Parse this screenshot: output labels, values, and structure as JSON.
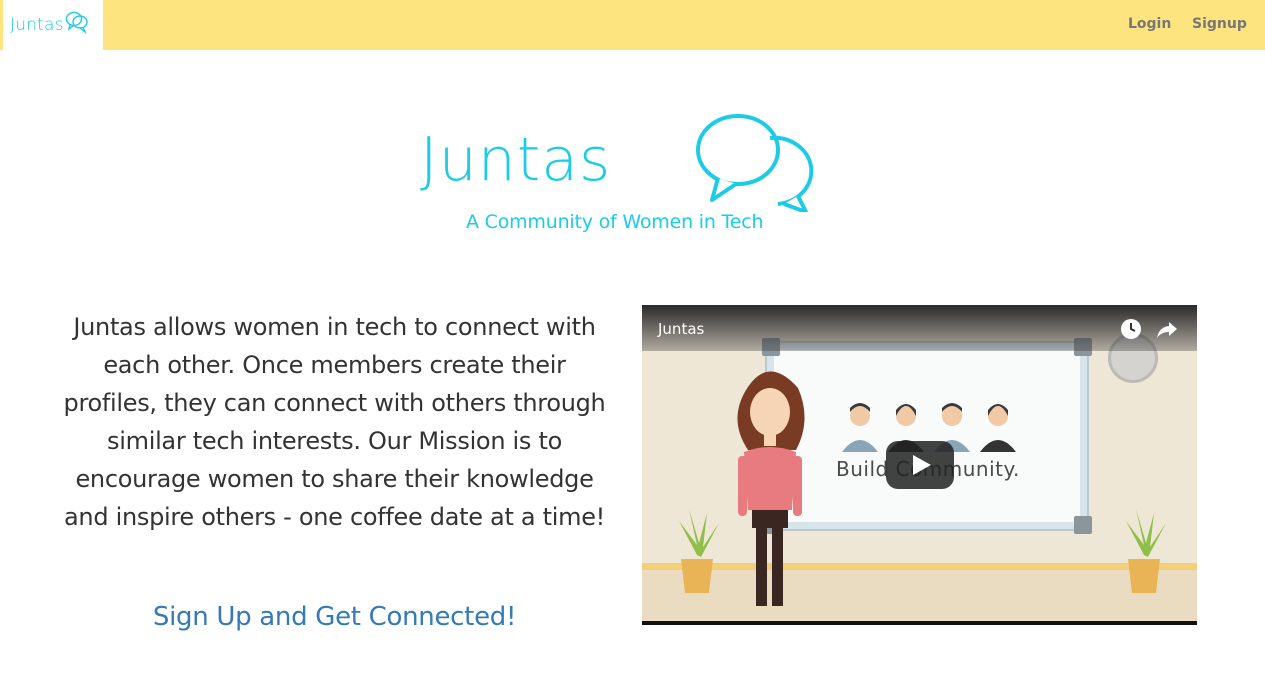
{
  "navbar": {
    "brand": "Juntas",
    "login_label": "Login",
    "signup_label": "Signup"
  },
  "hero": {
    "title": "Juntas",
    "tagline": "A Community of  Women in Tech"
  },
  "description": "Juntas allows women in tech to connect with each other. Once members create their profiles, they can connect with others through similar tech interests. Our Mission is to encourage women to share their knowledge and inspire others - one coffee date at a time!",
  "cta_label": "Sign Up and Get Connected!",
  "video": {
    "title": "Juntas",
    "slide_text": "Build Community.",
    "icons": [
      "watch-later-icon",
      "share-icon",
      "play-icon"
    ]
  },
  "colors": {
    "navbar_bg": "#fde47f",
    "brand_cyan": "#1ccbe6",
    "link_blue": "#337ab7",
    "nav_link": "#777777"
  }
}
